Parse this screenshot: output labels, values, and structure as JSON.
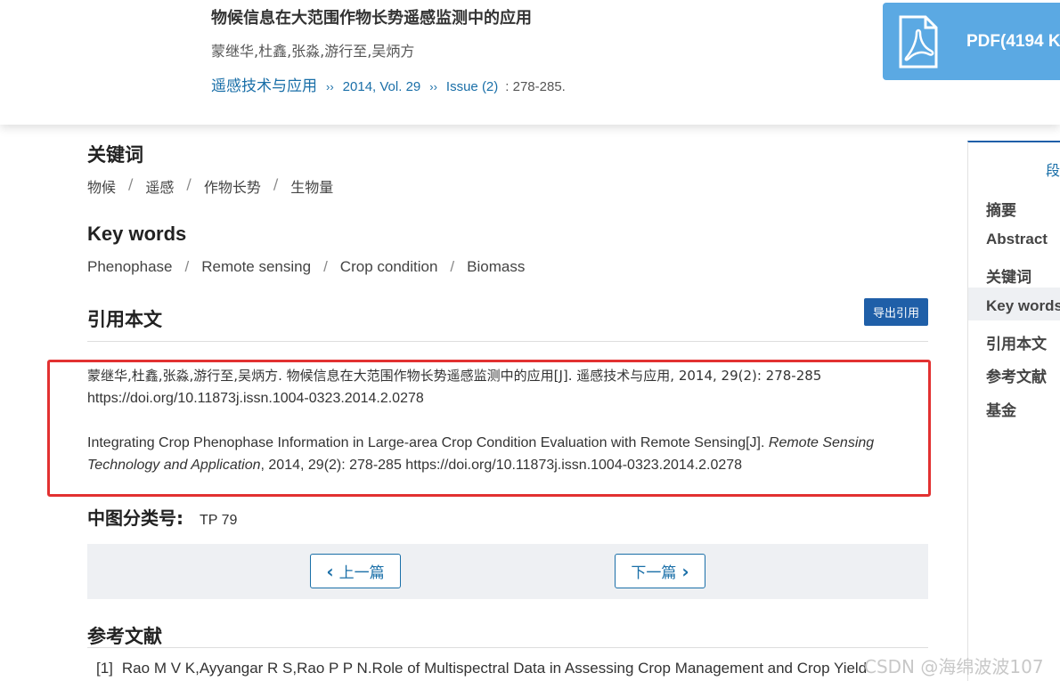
{
  "header": {
    "title": "物候信息在大范围作物长势遥感监测中的应用",
    "authors": "蒙继华,杜鑫,张淼,游行至,吴炳方",
    "journal": "遥感技术与应用",
    "breadcrumb_sep": "››",
    "year_vol": "2014, Vol. 29",
    "issue": "Issue (2)",
    "pages": ": 278-285.",
    "pdf_label": "PDF(4194 K"
  },
  "keywords_cn": {
    "heading": "关键词",
    "items": [
      "物候",
      "遥感",
      "作物长势",
      "生物量"
    ]
  },
  "keywords_en": {
    "heading": "Key words",
    "items": [
      "Phenophase",
      "Remote sensing",
      "Crop condition",
      "Biomass"
    ]
  },
  "citation": {
    "heading": "引用本文",
    "export_label": "导出引用",
    "cn_line1": "蒙继华,杜鑫,张淼,游行至,吴炳方. 物候信息在大范围作物长势遥感监测中的应用[J]. 遥感技术与应用, 2014, 29(2): 278-285",
    "cn_line2": "https://doi.org/10.11873j.issn.1004-0323.2014.2.0278",
    "en_part1": "Integrating Crop Phenophase Information in Large-area Crop Condition Evaluation with Remote Sensing[J]. ",
    "en_journal": "Remote Sensing Technology and Application",
    "en_part2": ", 2014, 29(2): 278-285 https://doi.org/10.11873j.issn.1004-0323.2014.2.0278"
  },
  "clc": {
    "label": "中图分类号:",
    "value": "TP 79"
  },
  "pager": {
    "prev_label": "上一篇",
    "next_label": "下一篇",
    "prev_chev": "‹",
    "next_chev": "›"
  },
  "references": {
    "heading": "参考文献",
    "items": [
      {
        "num": "[1]",
        "text": "Rao M V K,Ayyangar R S,Rao P P N.Role of Multispectral Data in Assessing Crop Management and Crop Yield"
      }
    ]
  },
  "side_nav": {
    "top": "段",
    "items": [
      "摘要",
      "Abstract",
      "关键词",
      "Key words",
      "引用本文",
      "参考文献",
      "基金"
    ],
    "active": "Key words"
  },
  "watermark": "CSDN @海绵波波107",
  "colors": {
    "link": "#1a6fa8",
    "pdf_button": "#5ba9e3",
    "export_button": "#1f5fa8",
    "highlight_frame": "#e23131"
  }
}
